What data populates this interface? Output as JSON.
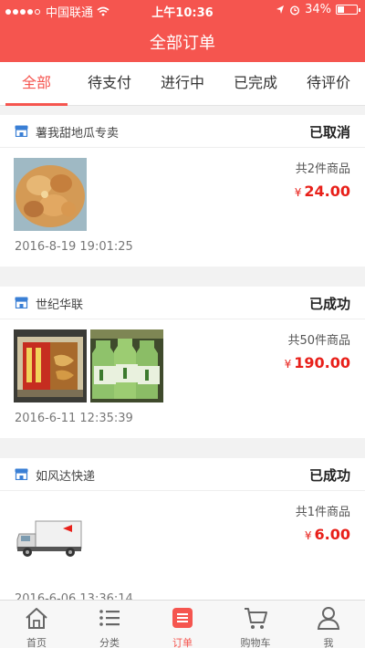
{
  "status_bar": {
    "carrier": "中国联通",
    "time": "上午10:36",
    "battery": "34%",
    "battery_level": 0.34
  },
  "header": {
    "title": "全部订单"
  },
  "tabs": [
    {
      "label": "全部",
      "active": true
    },
    {
      "label": "待支付"
    },
    {
      "label": "进行中"
    },
    {
      "label": "已完成"
    },
    {
      "label": "待评价"
    }
  ],
  "orders": [
    {
      "shop": "薯我甜地瓜专卖",
      "status": "已取消",
      "count": "共2件商品",
      "currency": "¥",
      "price": "24.00",
      "date": "2016-8-19 19:01:25",
      "images": [
        "sweet-potato-dish"
      ]
    },
    {
      "shop": "世纪华联",
      "status": "已成功",
      "count": "共50件商品",
      "currency": "¥",
      "price": "190.00",
      "date": "2016-6-11 12:35:39",
      "images": [
        "instant-noodles-pack",
        "green-tea-bottles"
      ]
    },
    {
      "shop": "如风达快递",
      "status": "已成功",
      "count": "共1件商品",
      "currency": "¥",
      "price": "6.00",
      "date": "2016-6-06 13:36:14",
      "images": [
        "delivery-truck"
      ]
    }
  ],
  "bottom_nav": [
    {
      "label": "首页",
      "icon": "home-icon"
    },
    {
      "label": "分类",
      "icon": "list-icon"
    },
    {
      "label": "订单",
      "icon": "order-icon",
      "active": true
    },
    {
      "label": "购物车",
      "icon": "cart-icon"
    },
    {
      "label": "我",
      "icon": "user-icon"
    }
  ],
  "colors": {
    "accent": "#f5554f",
    "price": "#e8201a"
  }
}
